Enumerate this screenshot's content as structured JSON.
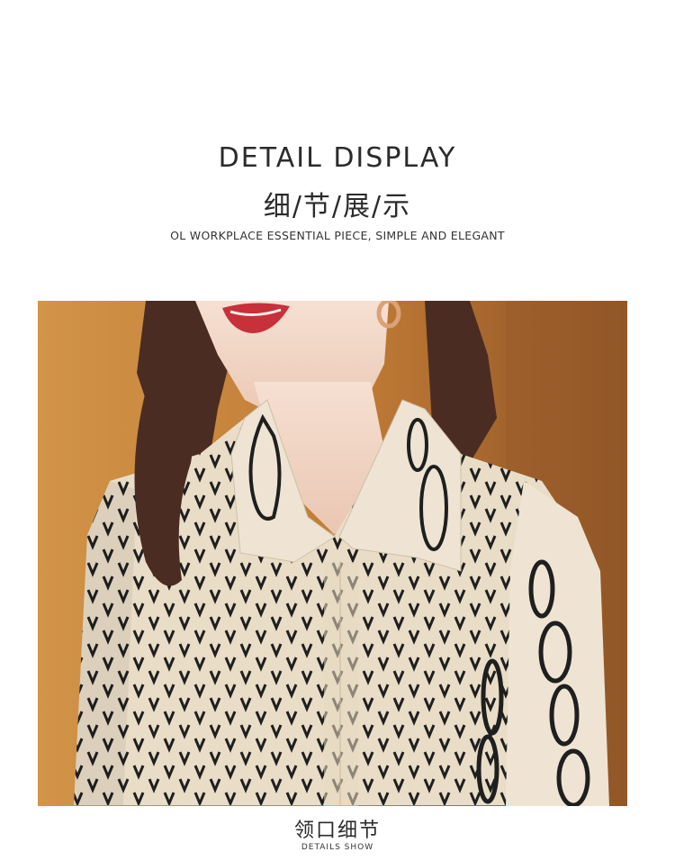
{
  "header": {
    "title": "DETAIL DISPLAY",
    "subtitle_cn": "细/节/展/示",
    "tagline": "OL WORKPLACE ESSENTIAL PIECE, SIMPLE AND ELEGANT"
  },
  "photo": {
    "subject": "model-wearing-v-print-blouse",
    "colors": {
      "background": "#c8893f",
      "fabric": "#eaddc8",
      "print": "#1f1f1f",
      "hair": "#4a2c22",
      "skin": "#f2d5c4",
      "lips": "#c8303a"
    }
  },
  "footer": {
    "caption_cn": "领口细节",
    "caption_en": "DETAILS SHOW"
  }
}
